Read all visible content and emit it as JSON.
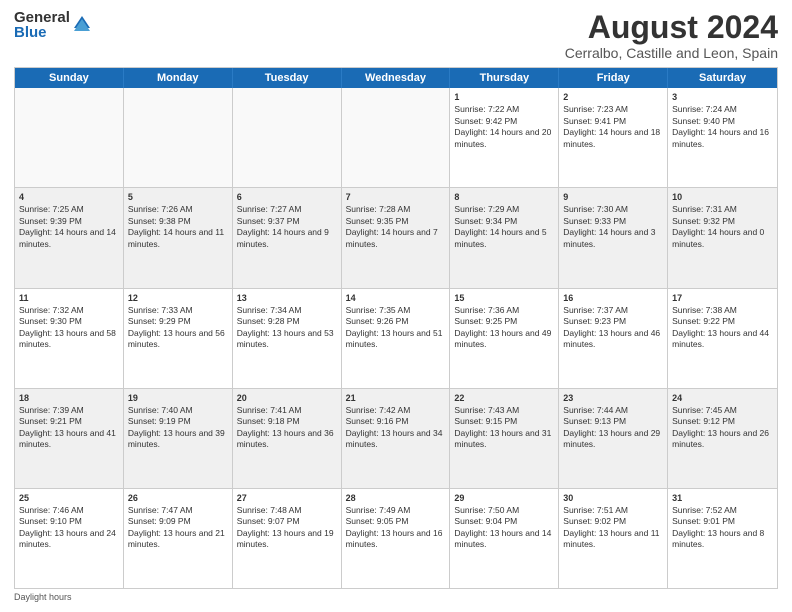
{
  "logo": {
    "general": "General",
    "blue": "Blue"
  },
  "title": "August 2024",
  "subtitle": "Cerralbo, Castille and Leon, Spain",
  "days": [
    "Sunday",
    "Monday",
    "Tuesday",
    "Wednesday",
    "Thursday",
    "Friday",
    "Saturday"
  ],
  "footer": "Daylight hours",
  "weeks": [
    [
      {
        "day": "",
        "content": ""
      },
      {
        "day": "",
        "content": ""
      },
      {
        "day": "",
        "content": ""
      },
      {
        "day": "",
        "content": ""
      },
      {
        "day": "1",
        "content": "Sunrise: 7:22 AM\nSunset: 9:42 PM\nDaylight: 14 hours and 20 minutes."
      },
      {
        "day": "2",
        "content": "Sunrise: 7:23 AM\nSunset: 9:41 PM\nDaylight: 14 hours and 18 minutes."
      },
      {
        "day": "3",
        "content": "Sunrise: 7:24 AM\nSunset: 9:40 PM\nDaylight: 14 hours and 16 minutes."
      }
    ],
    [
      {
        "day": "4",
        "content": "Sunrise: 7:25 AM\nSunset: 9:39 PM\nDaylight: 14 hours and 14 minutes."
      },
      {
        "day": "5",
        "content": "Sunrise: 7:26 AM\nSunset: 9:38 PM\nDaylight: 14 hours and 11 minutes."
      },
      {
        "day": "6",
        "content": "Sunrise: 7:27 AM\nSunset: 9:37 PM\nDaylight: 14 hours and 9 minutes."
      },
      {
        "day": "7",
        "content": "Sunrise: 7:28 AM\nSunset: 9:35 PM\nDaylight: 14 hours and 7 minutes."
      },
      {
        "day": "8",
        "content": "Sunrise: 7:29 AM\nSunset: 9:34 PM\nDaylight: 14 hours and 5 minutes."
      },
      {
        "day": "9",
        "content": "Sunrise: 7:30 AM\nSunset: 9:33 PM\nDaylight: 14 hours and 3 minutes."
      },
      {
        "day": "10",
        "content": "Sunrise: 7:31 AM\nSunset: 9:32 PM\nDaylight: 14 hours and 0 minutes."
      }
    ],
    [
      {
        "day": "11",
        "content": "Sunrise: 7:32 AM\nSunset: 9:30 PM\nDaylight: 13 hours and 58 minutes."
      },
      {
        "day": "12",
        "content": "Sunrise: 7:33 AM\nSunset: 9:29 PM\nDaylight: 13 hours and 56 minutes."
      },
      {
        "day": "13",
        "content": "Sunrise: 7:34 AM\nSunset: 9:28 PM\nDaylight: 13 hours and 53 minutes."
      },
      {
        "day": "14",
        "content": "Sunrise: 7:35 AM\nSunset: 9:26 PM\nDaylight: 13 hours and 51 minutes."
      },
      {
        "day": "15",
        "content": "Sunrise: 7:36 AM\nSunset: 9:25 PM\nDaylight: 13 hours and 49 minutes."
      },
      {
        "day": "16",
        "content": "Sunrise: 7:37 AM\nSunset: 9:23 PM\nDaylight: 13 hours and 46 minutes."
      },
      {
        "day": "17",
        "content": "Sunrise: 7:38 AM\nSunset: 9:22 PM\nDaylight: 13 hours and 44 minutes."
      }
    ],
    [
      {
        "day": "18",
        "content": "Sunrise: 7:39 AM\nSunset: 9:21 PM\nDaylight: 13 hours and 41 minutes."
      },
      {
        "day": "19",
        "content": "Sunrise: 7:40 AM\nSunset: 9:19 PM\nDaylight: 13 hours and 39 minutes."
      },
      {
        "day": "20",
        "content": "Sunrise: 7:41 AM\nSunset: 9:18 PM\nDaylight: 13 hours and 36 minutes."
      },
      {
        "day": "21",
        "content": "Sunrise: 7:42 AM\nSunset: 9:16 PM\nDaylight: 13 hours and 34 minutes."
      },
      {
        "day": "22",
        "content": "Sunrise: 7:43 AM\nSunset: 9:15 PM\nDaylight: 13 hours and 31 minutes."
      },
      {
        "day": "23",
        "content": "Sunrise: 7:44 AM\nSunset: 9:13 PM\nDaylight: 13 hours and 29 minutes."
      },
      {
        "day": "24",
        "content": "Sunrise: 7:45 AM\nSunset: 9:12 PM\nDaylight: 13 hours and 26 minutes."
      }
    ],
    [
      {
        "day": "25",
        "content": "Sunrise: 7:46 AM\nSunset: 9:10 PM\nDaylight: 13 hours and 24 minutes."
      },
      {
        "day": "26",
        "content": "Sunrise: 7:47 AM\nSunset: 9:09 PM\nDaylight: 13 hours and 21 minutes."
      },
      {
        "day": "27",
        "content": "Sunrise: 7:48 AM\nSunset: 9:07 PM\nDaylight: 13 hours and 19 minutes."
      },
      {
        "day": "28",
        "content": "Sunrise: 7:49 AM\nSunset: 9:05 PM\nDaylight: 13 hours and 16 minutes."
      },
      {
        "day": "29",
        "content": "Sunrise: 7:50 AM\nSunset: 9:04 PM\nDaylight: 13 hours and 14 minutes."
      },
      {
        "day": "30",
        "content": "Sunrise: 7:51 AM\nSunset: 9:02 PM\nDaylight: 13 hours and 11 minutes."
      },
      {
        "day": "31",
        "content": "Sunrise: 7:52 AM\nSunset: 9:01 PM\nDaylight: 13 hours and 8 minutes."
      }
    ]
  ]
}
